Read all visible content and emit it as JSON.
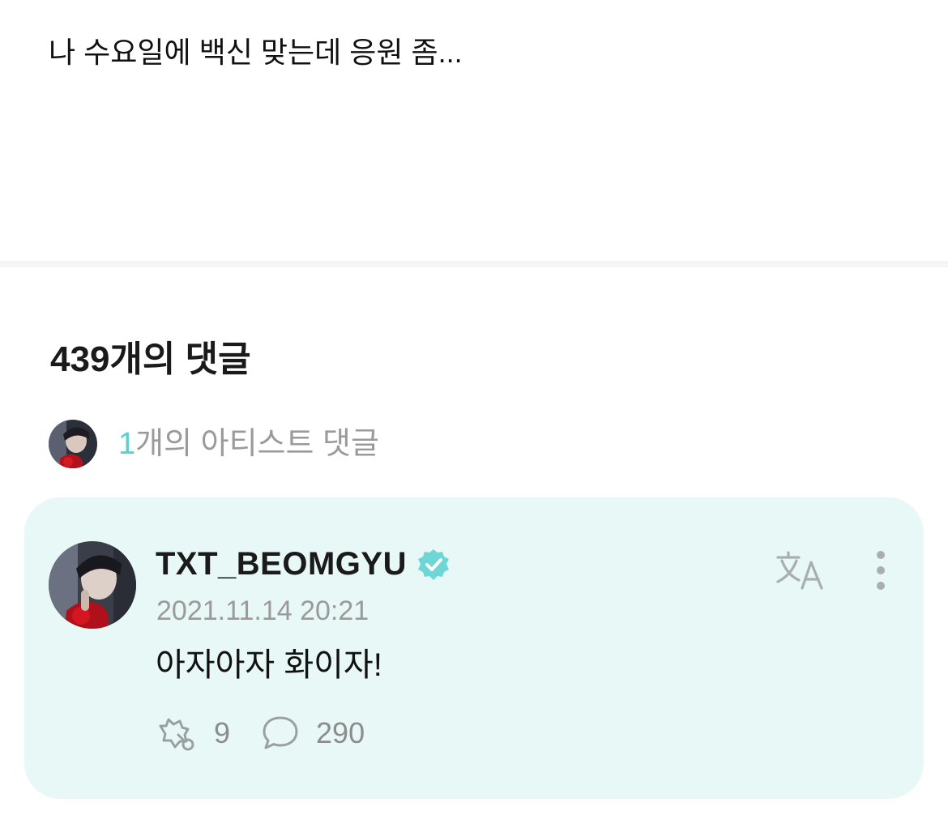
{
  "post": {
    "text": "나 수요일에 백신 맞는데 응원 좀..."
  },
  "comments": {
    "title": "439개의 댓글",
    "artist_summary": {
      "count": "1",
      "label": "개의 아티스트 댓글"
    }
  },
  "artist_comment": {
    "author": "TXT_BEOMGYU",
    "timestamp": "2021.11.14 20:21",
    "text": "아자아자 화이자!",
    "likes": "9",
    "replies": "290"
  },
  "icons": {
    "verified": "verified-badge-icon",
    "translate": "translate-icon",
    "more": "more-vertical-icon",
    "like": "hand-heart-icon",
    "reply": "speech-bubble-icon"
  },
  "colors": {
    "accent": "#5ccfcf",
    "card_background": "#e8f8f6",
    "muted_text": "#9a9a9a"
  }
}
